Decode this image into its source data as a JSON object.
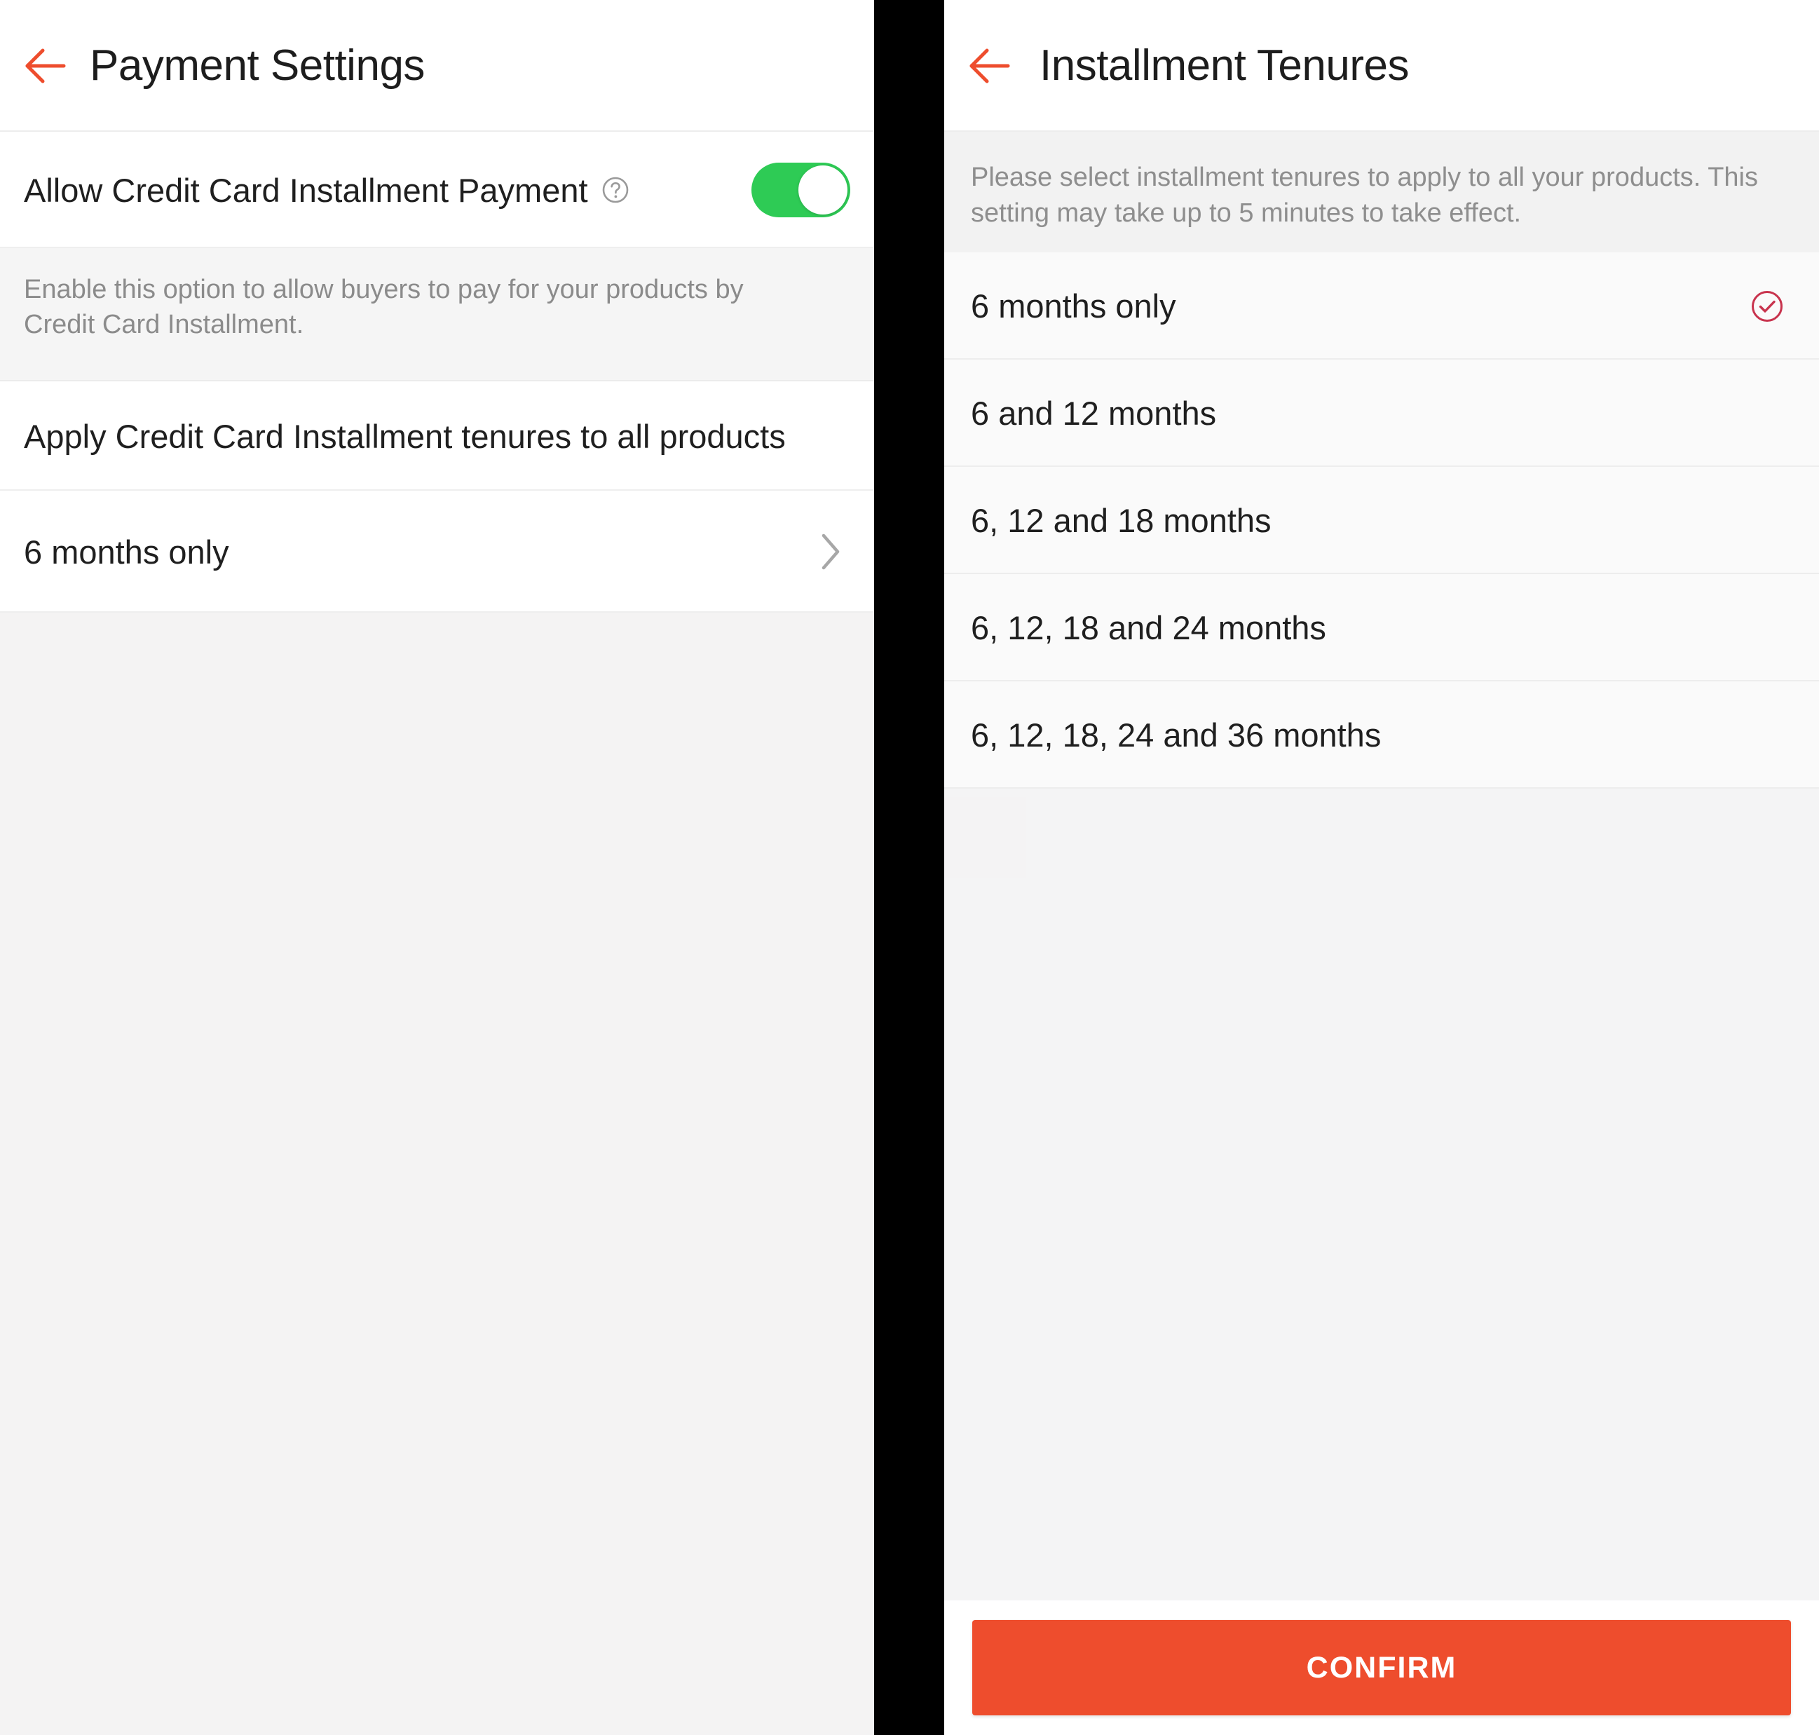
{
  "theme": {
    "accent_orange": "#ee4d2d",
    "toggle_green": "#2ecb55",
    "check_crimson": "#c8334d",
    "page_background": "#f4f3f3",
    "divider_black": "#000000"
  },
  "left_panel": {
    "appbar": {
      "back_icon": "arrow-left-icon",
      "title": "Payment Settings"
    },
    "toggle_row": {
      "label": "Allow Credit Card Installment Payment",
      "help_icon": "question-mark-circle-icon",
      "toggle_state": "on"
    },
    "help_block": {
      "text": "Enable this option to allow buyers to pay for your products by Credit Card Installment."
    },
    "apply_row": {
      "label": "Apply Credit Card Installment tenures to all products"
    },
    "tenure_row": {
      "label": "6 months only",
      "chevron_icon": "chevron-right-icon"
    }
  },
  "right_panel": {
    "appbar": {
      "back_icon": "arrow-left-icon",
      "title": "Installment Tenures"
    },
    "instructions": {
      "text": "Please select installment tenures to apply to all your products. This setting may take up to 5 minutes to take effect."
    },
    "options": [
      {
        "label": "6 months only",
        "selected": true
      },
      {
        "label": "6 and 12 months",
        "selected": false
      },
      {
        "label": "6, 12 and 18 months",
        "selected": false
      },
      {
        "label": "6, 12, 18 and 24 months",
        "selected": false
      },
      {
        "label": "6, 12, 18, 24 and 36 months",
        "selected": false
      }
    ],
    "selected_option": "6 months only",
    "check_icon": "check-circle-icon",
    "confirm_button": {
      "label": "CONFIRM"
    }
  }
}
